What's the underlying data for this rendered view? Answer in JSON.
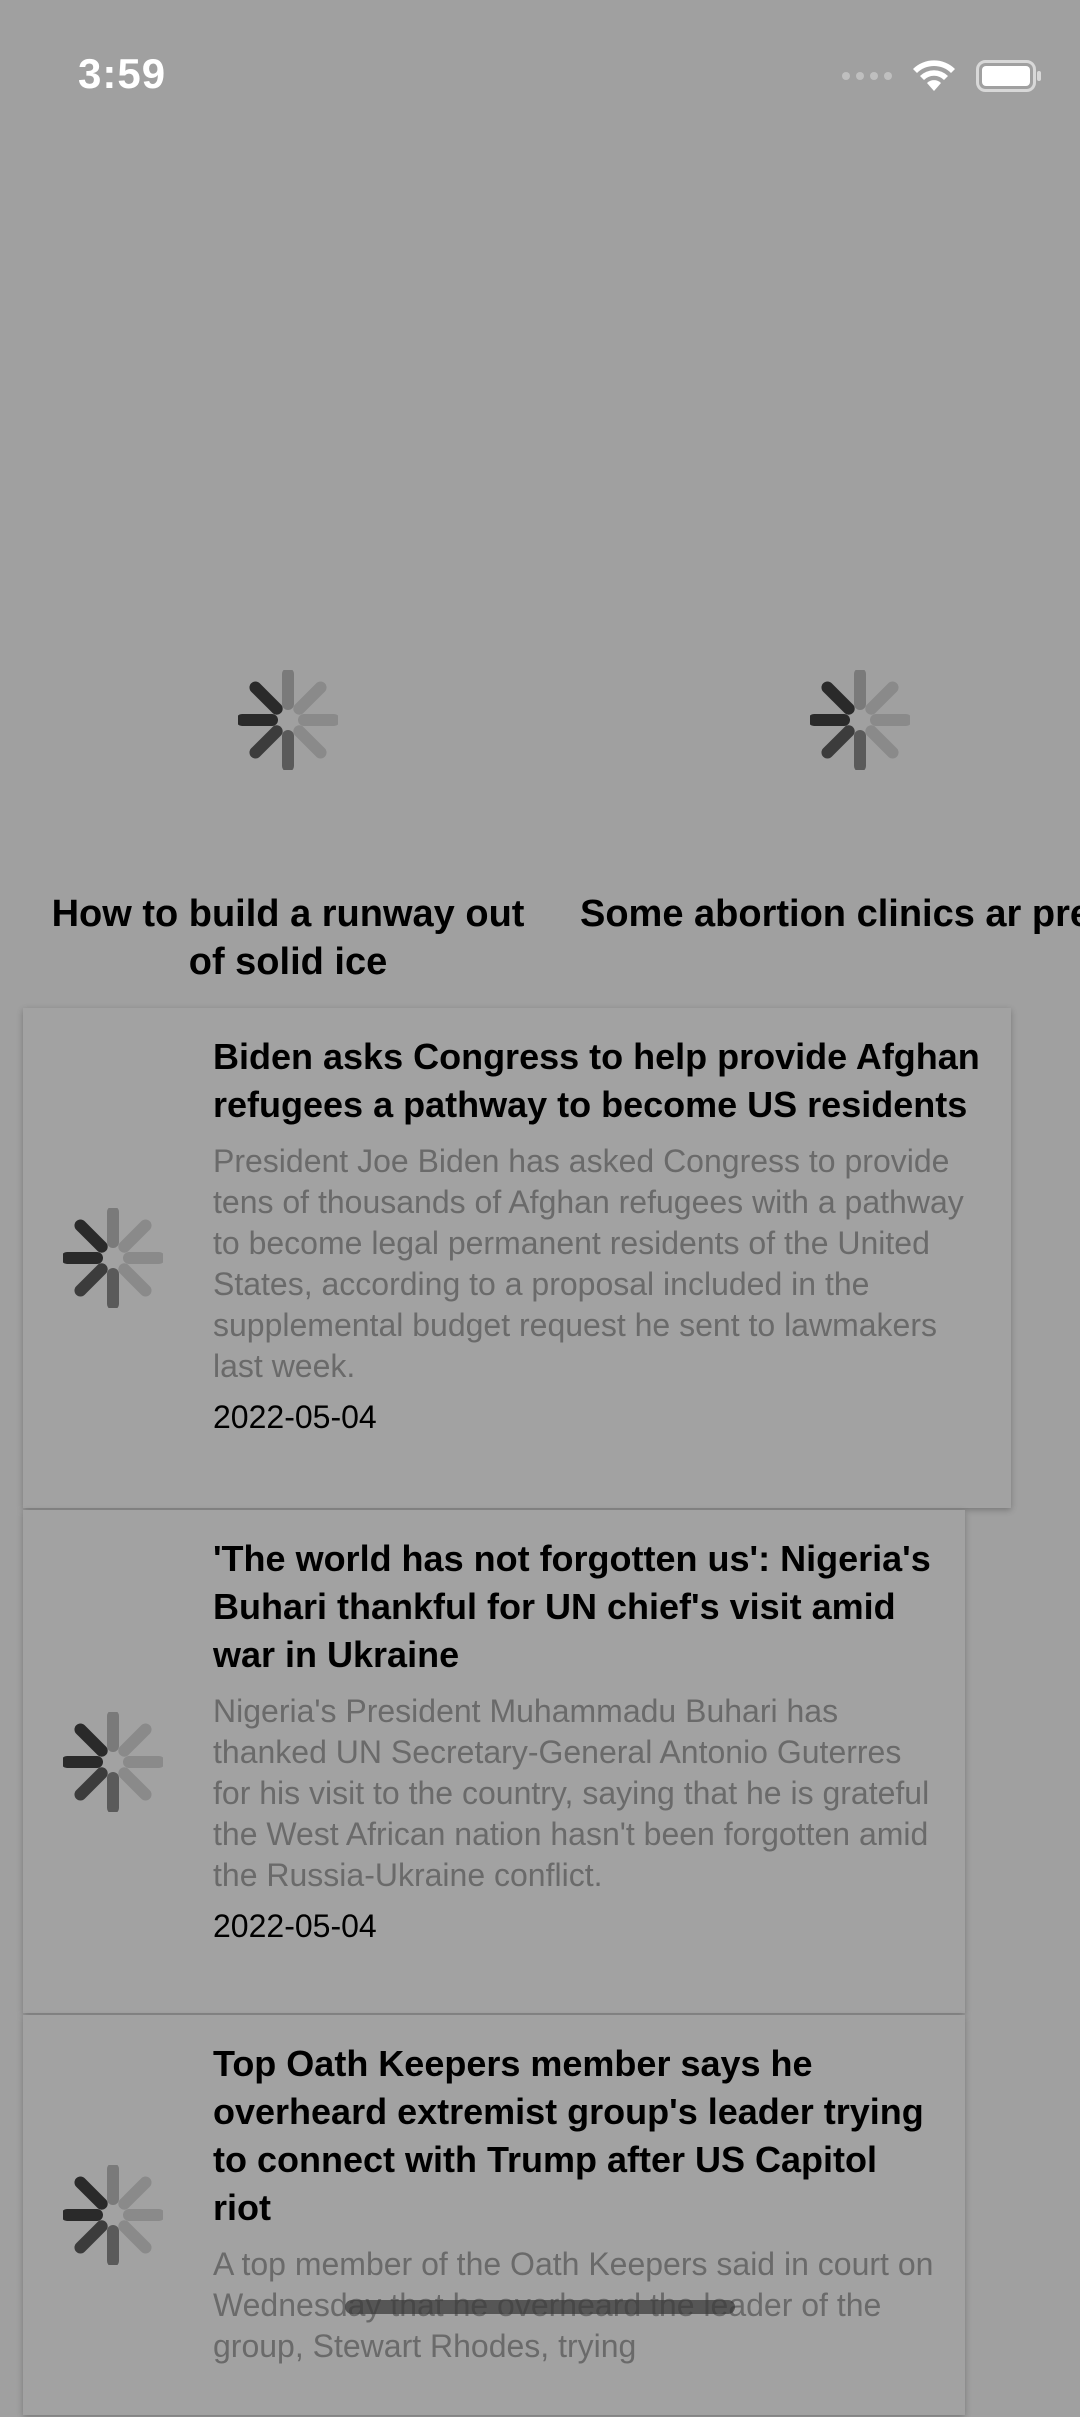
{
  "status_bar": {
    "time": "3:59",
    "icons": [
      "signal-icon",
      "wifi-icon",
      "battery-icon"
    ]
  },
  "featured": [
    {
      "title": "How to build a runway out\nof solid ice",
      "image": "loading-spinner-icon"
    },
    {
      "title": "Some abortion clinics ar\npreparing for more out-o",
      "image": "loading-spinner-icon"
    }
  ],
  "news": [
    {
      "headline": "Biden asks Congress to help provide Afghan refugees a pathway to become US residents",
      "summary": "President Joe Biden has asked Congress to provide tens of thousands of Afghan refugees with a pathway to become legal permanent residents of the United States, according to a proposal included in the supplemental budget request he sent to lawmakers last week.",
      "date": "2022-05-04"
    },
    {
      "headline": "'The world has not forgotten us': Nigeria's Buhari thankful for UN chief's visit amid war in Ukraine",
      "summary": "Nigeria's President Muhammadu Buhari has thanked UN Secretary-General Antonio Guterres for his visit to the country, saying that he is grateful the West African nation hasn't been forgotten amid the Russia-Ukraine conflict.",
      "date": "2022-05-04"
    },
    {
      "headline": "Top Oath Keepers member says he overheard extremist group's leader trying to connect with Trump after US Capitol riot",
      "summary": "A top member of the Oath Keepers said in court on Wednesday that he overheard the leader of the group, Stewart Rhodes, trying",
      "date": ""
    }
  ],
  "colors": {
    "background": "#a0a0a0",
    "summary_text": "#6a6a6a",
    "status_text": "#ffffff"
  }
}
